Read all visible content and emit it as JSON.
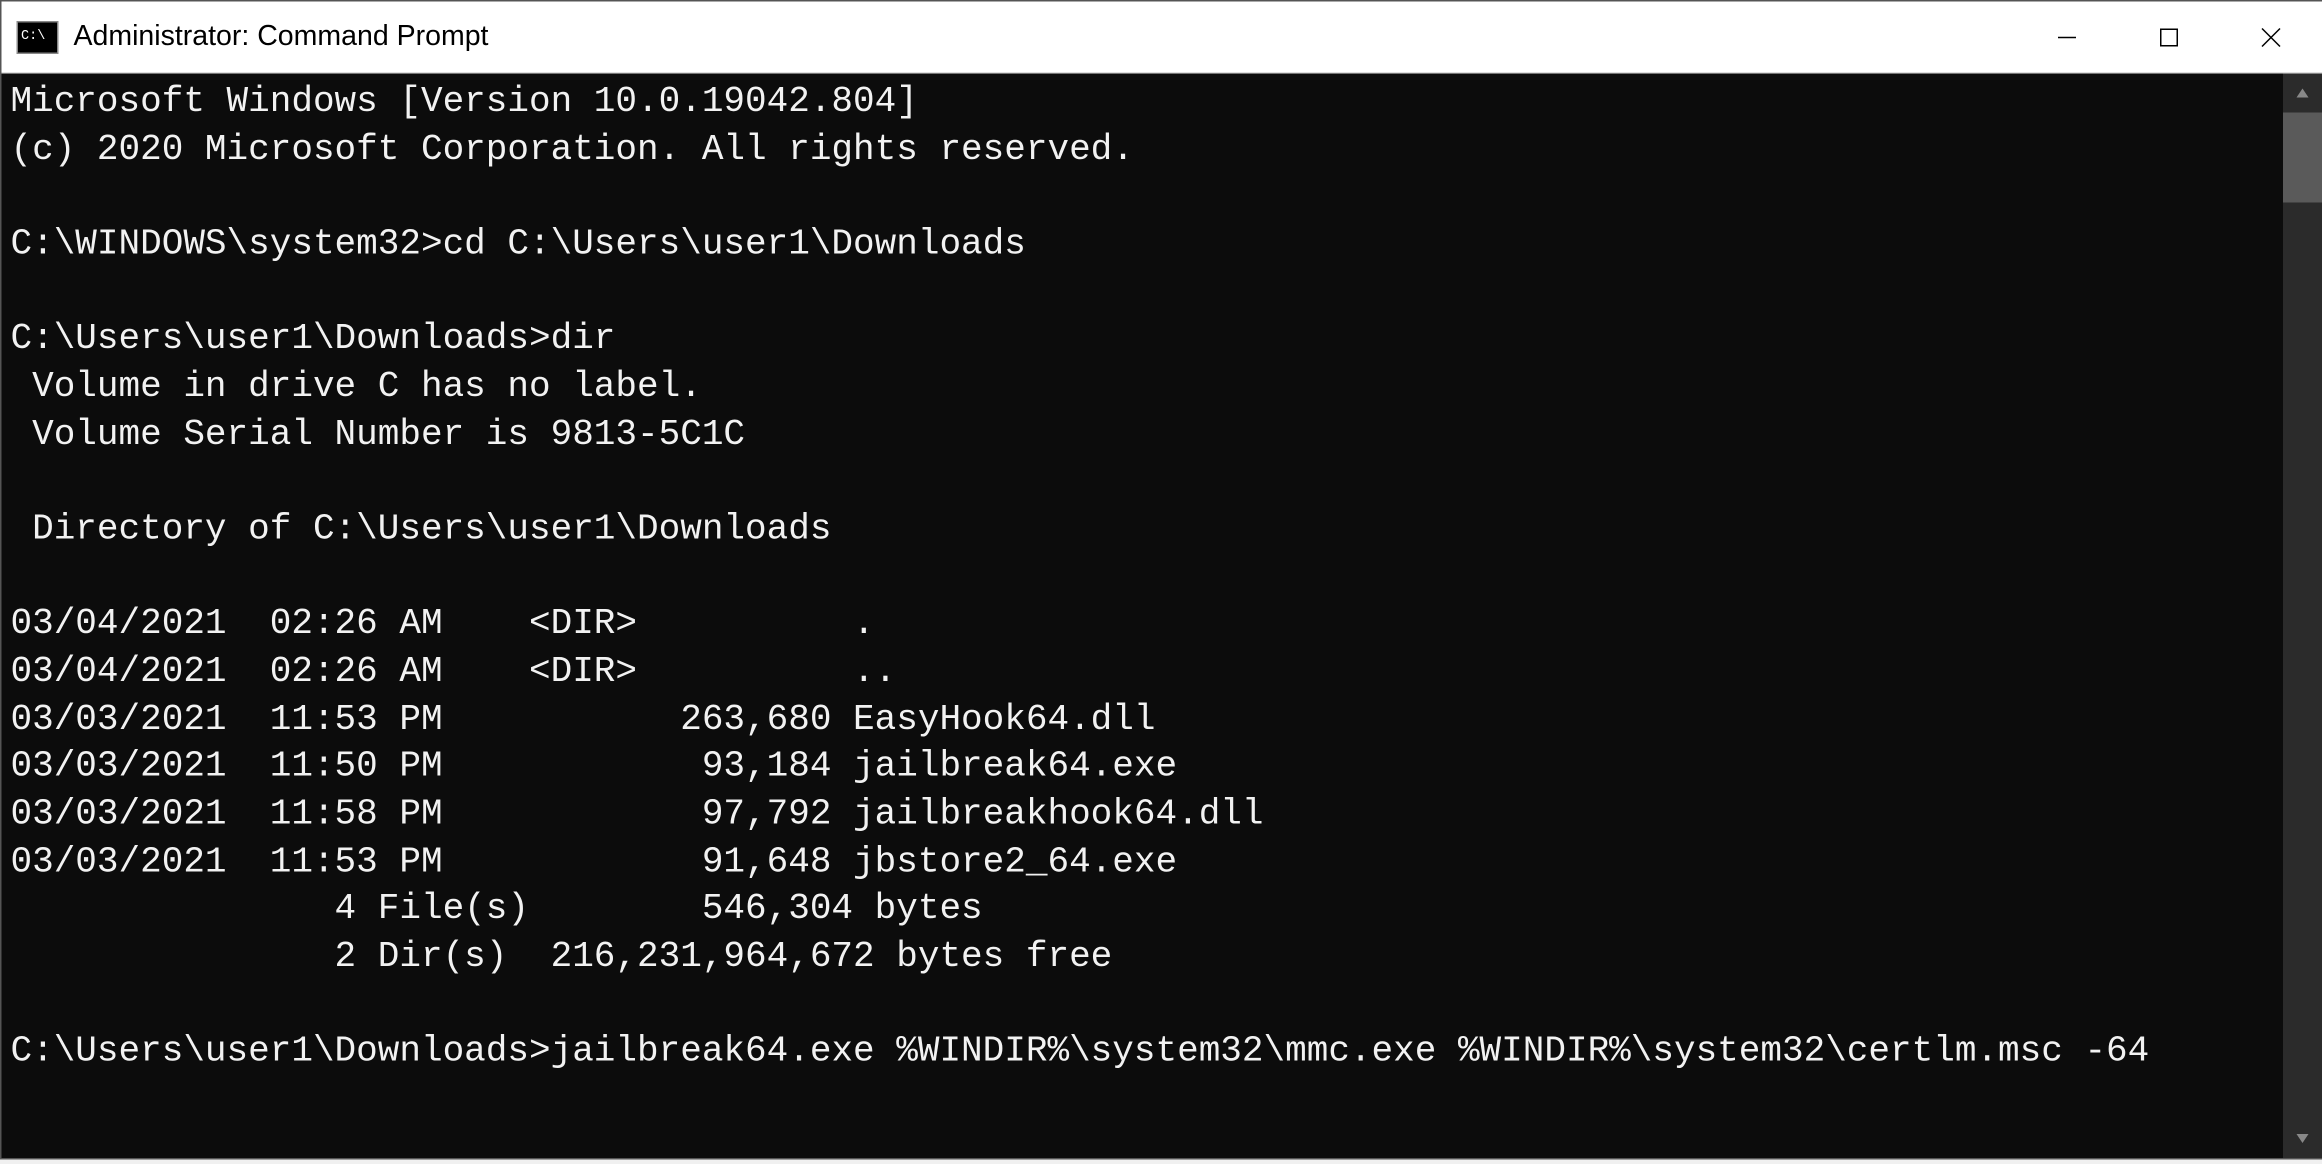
{
  "window": {
    "title": "Administrator: Command Prompt"
  },
  "terminal": {
    "banner_line1": "Microsoft Windows [Version 10.0.19042.804]",
    "banner_line2": "(c) 2020 Microsoft Corporation. All rights reserved.",
    "prompt1_path": "C:\\WINDOWS\\system32>",
    "prompt1_cmd": "cd C:\\Users\\user1\\Downloads",
    "prompt2_path": "C:\\Users\\user1\\Downloads>",
    "prompt2_cmd": "dir",
    "dir_vol1": " Volume in drive C has no label.",
    "dir_vol2": " Volume Serial Number is 9813-5C1C",
    "dir_header": " Directory of C:\\Users\\user1\\Downloads",
    "entries": [
      "03/04/2021  02:26 AM    <DIR>          .",
      "03/04/2021  02:26 AM    <DIR>          ..",
      "03/03/2021  11:53 PM           263,680 EasyHook64.dll",
      "03/03/2021  11:50 PM            93,184 jailbreak64.exe",
      "03/03/2021  11:58 PM            97,792 jailbreakhook64.dll",
      "03/03/2021  11:53 PM            91,648 jbstore2_64.exe"
    ],
    "summary1": "               4 File(s)        546,304 bytes",
    "summary2": "               2 Dir(s)  216,231,964,672 bytes free",
    "prompt3_path": "C:\\Users\\user1\\Downloads>",
    "prompt3_cmd": "jailbreak64.exe %WINDIR%\\system32\\mmc.exe %WINDIR%\\system32\\certlm.msc -64"
  }
}
